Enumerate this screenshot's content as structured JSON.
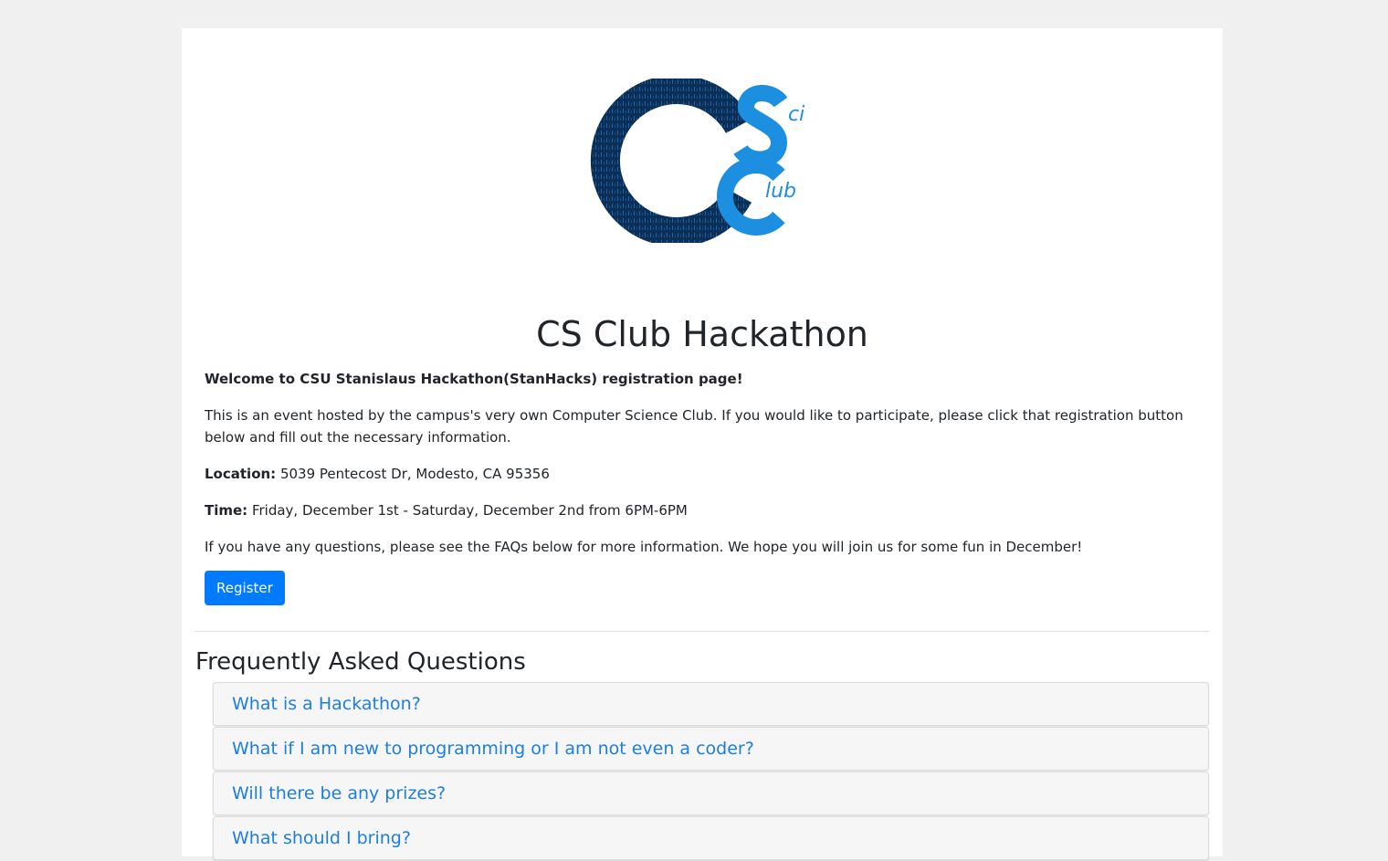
{
  "header": {
    "logo_text": "CSci Club",
    "title": "CS Club Hackathon"
  },
  "intro": {
    "welcome": "Welcome to CSU Stanislaus Hackathon(StanHacks) registration page!",
    "description": "This is an event hosted by the campus's very own Computer Science Club. If you would like to participate, please click that registration button below and fill out the necessary information.",
    "location_label": "Location:",
    "location_value": "5039 Pentecost Dr, Modesto, CA 95356",
    "time_label": "Time:",
    "time_value": "Friday, December 1st - Saturday, December 2nd from 6PM-6PM",
    "questions_text": "If you have any questions, please see the FAQs below for more information. We hope you will join us for some fun in December!",
    "register_label": "Register"
  },
  "faq": {
    "heading": "Frequently Asked Questions",
    "items": [
      {
        "question": "What is a Hackathon?"
      },
      {
        "question": "What if I am new to programming or I am not even a coder?"
      },
      {
        "question": "Will there be any prizes?"
      },
      {
        "question": "What should I bring?"
      }
    ]
  },
  "colors": {
    "page_background": "#f0f0f0",
    "primary_button": "#007bff",
    "link": "#1e7ee0",
    "logo_dark": "#0a2d52",
    "logo_light": "#1c8fe0"
  },
  "icons": [
    "csci-club-logo-icon"
  ]
}
